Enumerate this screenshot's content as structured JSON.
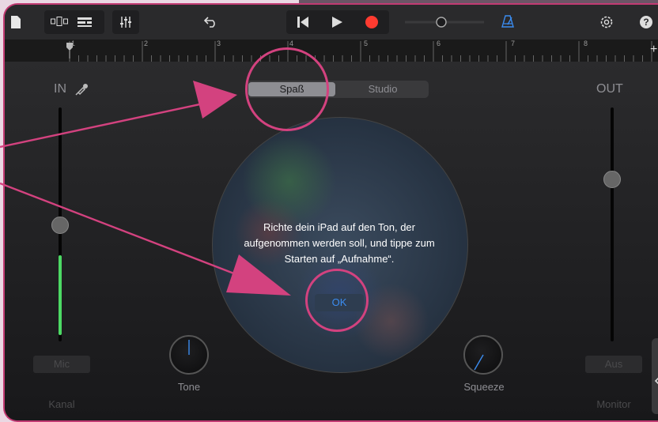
{
  "toolbar": {
    "icons": [
      "document-icon",
      "tracks-view-icon",
      "list-view-icon",
      "mixer-icon",
      "undo-icon",
      "rewind-icon",
      "play-icon",
      "record-icon",
      "master-volume-icon",
      "metronome-icon",
      "settings-icon",
      "help-icon"
    ],
    "help_label": "?"
  },
  "ruler": {
    "marks": [
      "1",
      "2",
      "3",
      "4",
      "5",
      "6",
      "7",
      "8"
    ],
    "add_label": "+"
  },
  "input": {
    "label": "IN"
  },
  "output": {
    "label": "OUT"
  },
  "mode": {
    "options": [
      "Spaß",
      "Studio"
    ],
    "selected": "Spaß"
  },
  "dialog": {
    "message": "Richte dein iPad auf den Ton, der aufgenommen werden soll, und tippe zum Starten auf „Aufnahme“.",
    "ok_label": "OK"
  },
  "knobs": {
    "tone_label": "Tone",
    "squeeze_label": "Squeeze"
  },
  "bottom_left": {
    "button_label": "Mic",
    "caption": "Kanal"
  },
  "bottom_right": {
    "button_label": "Aus",
    "caption": "Monitor"
  },
  "colors": {
    "annotation": "#d3427f",
    "record": "#ff3b30",
    "accent": "#3b8cf0",
    "level": "#4cd964"
  },
  "levels": {
    "input_meter": 0.34,
    "input_slider": 0.5,
    "output_slider": 0.68
  }
}
